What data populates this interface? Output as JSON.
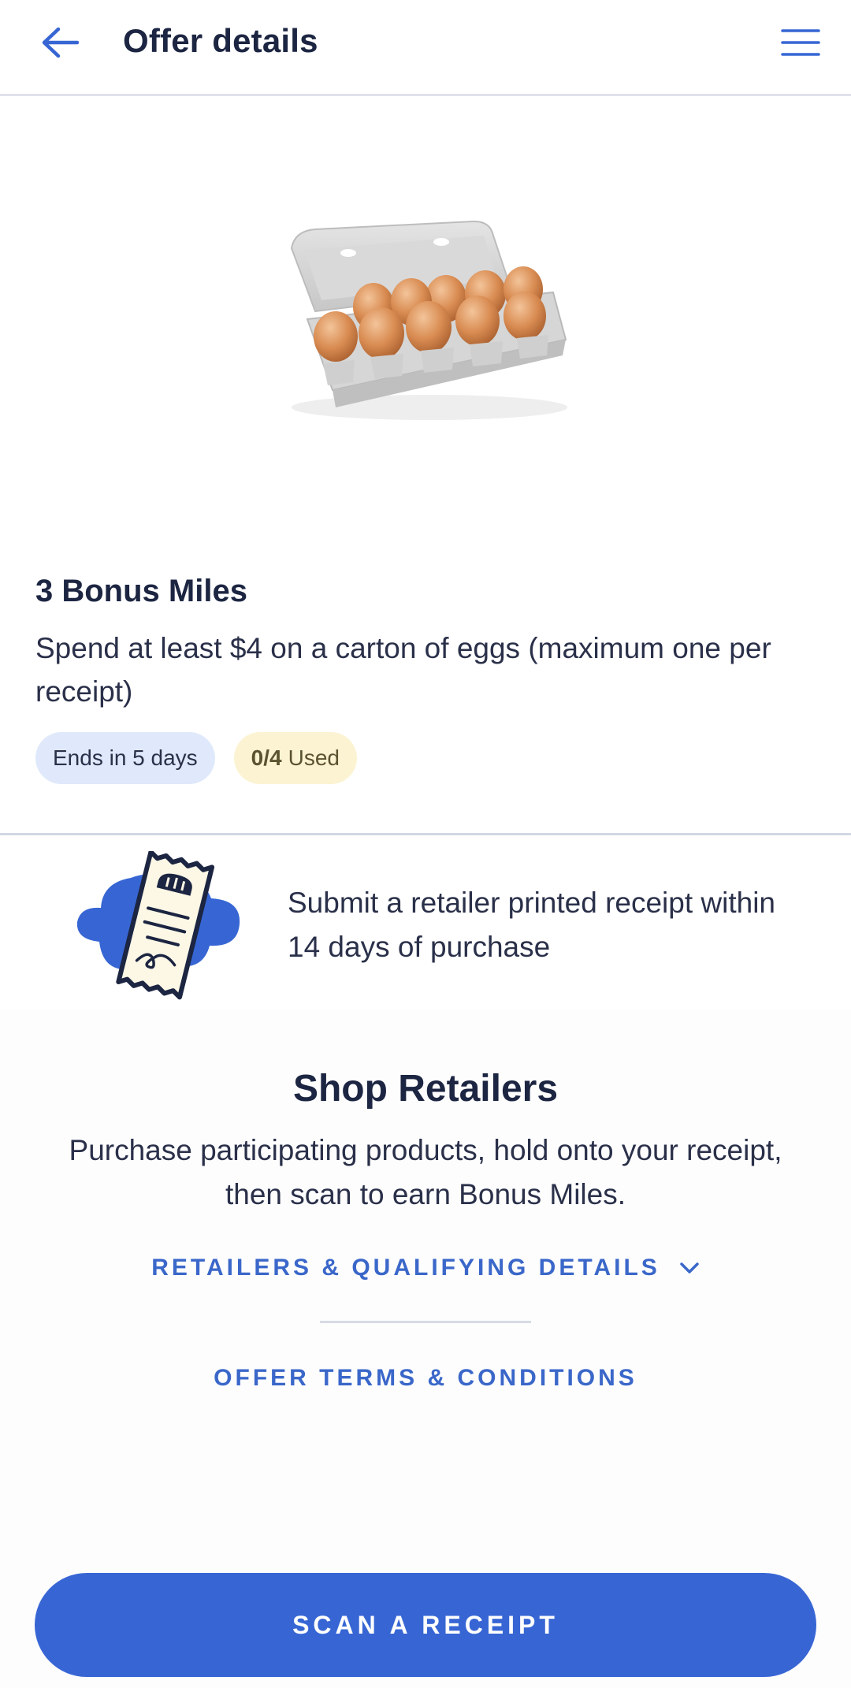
{
  "header": {
    "title": "Offer details",
    "back_icon": "arrow-left-icon",
    "menu_icon": "hamburger-menu-icon"
  },
  "hero": {
    "image": "egg-carton-image"
  },
  "offer": {
    "title": "3 Bonus Miles",
    "description": "Spend at least $4 on a carton of eggs (maximum one per receipt)",
    "ends_badge": "Ends in 5 days",
    "used_count": "0/4",
    "used_label": "Used"
  },
  "receipt_info": {
    "illustration": "receipt-illustration",
    "text": "Submit a retailer printed receipt within 14 days of purchase"
  },
  "shop": {
    "title": "Shop Retailers",
    "description": "Purchase participating products, hold onto your receipt, then scan to earn Bonus Miles.",
    "retailers_link": "RETAILERS & QUALIFYING DETAILS",
    "terms_link": "OFFER TERMS & CONDITIONS"
  },
  "actions": {
    "scan_button": "SCAN A RECEIPT"
  },
  "colors": {
    "accent": "#3766d4",
    "link": "#3a67c9",
    "text_dark": "#1c2541",
    "chip_blue": "#dfe9fb",
    "chip_yellow": "#fbf3d2"
  }
}
